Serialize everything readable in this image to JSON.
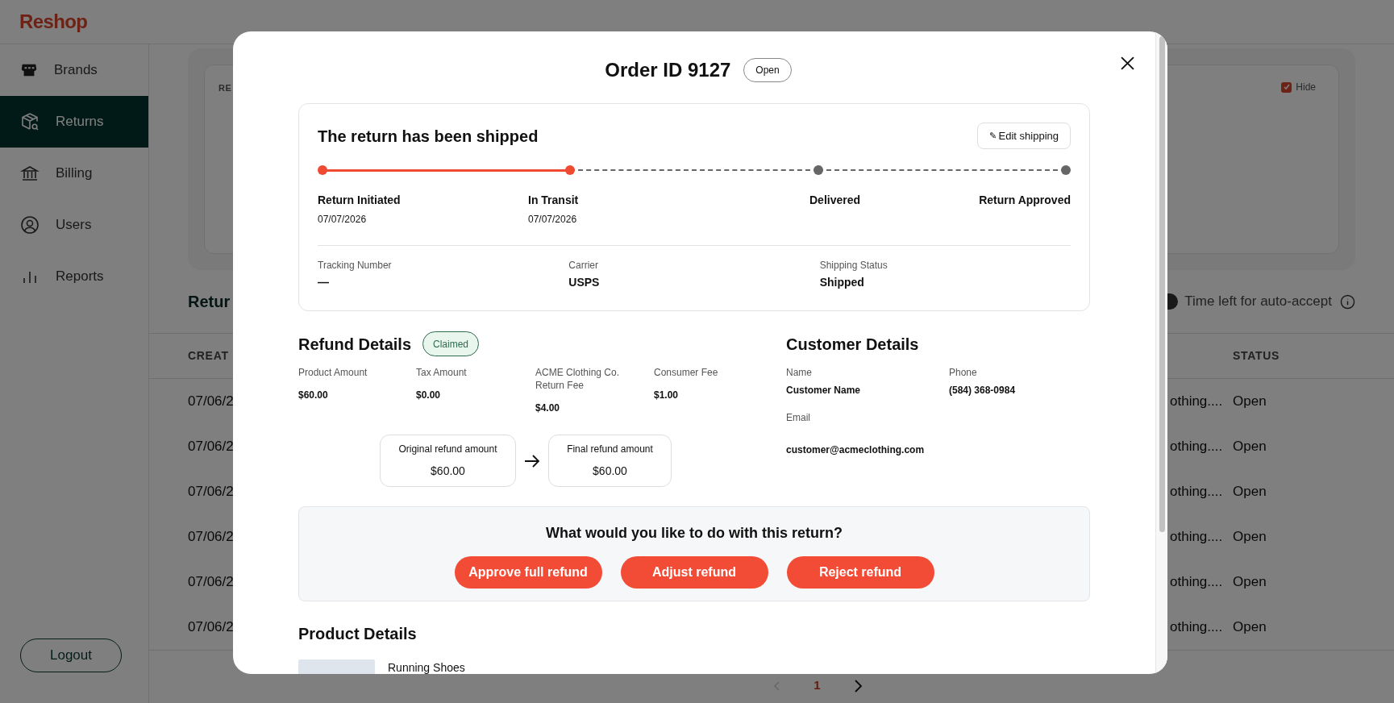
{
  "app": {
    "logo": "Reshop"
  },
  "sidebar": {
    "items": [
      {
        "label": "Brands",
        "selected": false
      },
      {
        "label": "Returns",
        "selected": true
      },
      {
        "label": "Billing",
        "selected": false
      },
      {
        "label": "Users",
        "selected": false
      },
      {
        "label": "Reports",
        "selected": false
      }
    ],
    "logout": "Logout"
  },
  "background": {
    "card_label": "RE",
    "hide_checkbox": {
      "label": "Hide",
      "checked": true
    },
    "section_title": "Retur",
    "auto_accept_toggle": {
      "on": true
    },
    "auto_accept_label": "Time left for auto-accept",
    "table": {
      "columns": [
        "CREAT",
        "STATUS"
      ],
      "rows": [
        {
          "created": "07/06/2",
          "column_2": "othing....",
          "status": "Open"
        },
        {
          "created": "07/06/2",
          "column_2": "othing....",
          "status": "Open"
        },
        {
          "created": "07/06/2",
          "column_2": "othing....",
          "status": "Open"
        },
        {
          "created": "07/06/2",
          "column_2": "othing....",
          "status": "Open"
        },
        {
          "created": "07/06/2",
          "column_2": "othing....",
          "status": "Open"
        },
        {
          "created": "07/06/2",
          "column_2": "othing....",
          "status": "Open"
        }
      ]
    },
    "pagination": {
      "current": "1"
    }
  },
  "modal": {
    "title": "Order ID 9127",
    "status_badge": "Open",
    "shipping": {
      "title": "The return has been shipped",
      "edit_button": "Edit shipping",
      "edit_icon": "✎",
      "steps": [
        {
          "label": "Return Initiated",
          "date": "07/07/2026",
          "reached": true
        },
        {
          "label": "In Transit",
          "date": "07/07/2026",
          "reached": true
        },
        {
          "label": "Delivered",
          "reached": false
        },
        {
          "label": "Return Approved",
          "reached": false
        }
      ],
      "fields": [
        {
          "label": "Tracking Number",
          "value": "—"
        },
        {
          "label": "Carrier",
          "value": "USPS"
        },
        {
          "label": "Shipping Status",
          "value": "Shipped"
        }
      ]
    },
    "refund": {
      "title": "Refund Details",
      "badge": "Claimed",
      "fields": [
        {
          "label": "Product Amount",
          "value": "$60.00"
        },
        {
          "label": "Tax Amount",
          "value": "$0.00"
        },
        {
          "label": "ACME Clothing Co. Return Fee",
          "value": "$4.00"
        },
        {
          "label": "Consumer Fee",
          "value": "$1.00"
        }
      ],
      "original": {
        "label": "Original refund amount",
        "value": "$60.00"
      },
      "final": {
        "label": "Final refund amount",
        "value": "$60.00"
      }
    },
    "customer": {
      "title": "Customer Details",
      "name": {
        "label": "Name",
        "value": "Customer Name"
      },
      "phone": {
        "label": "Phone",
        "value": "(584) 368-0984"
      },
      "email": {
        "label": "Email",
        "value": "customer@acmeclothing.com"
      }
    },
    "action": {
      "question": "What would you like to do with this return?",
      "buttons": [
        "Approve full refund",
        "Adjust refund",
        "Reject refund"
      ]
    },
    "products": {
      "title": "Product Details",
      "items": [
        {
          "name": "Running Shoes"
        }
      ]
    }
  }
}
